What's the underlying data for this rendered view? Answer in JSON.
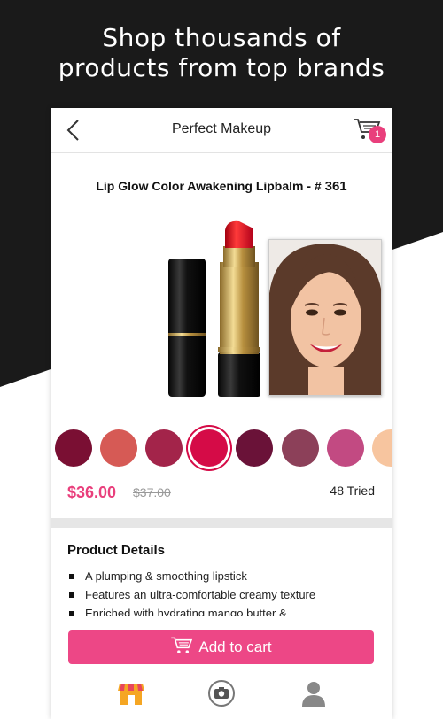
{
  "headline": {
    "line1": "Shop thousands of",
    "line2": "products from top brands"
  },
  "navbar": {
    "title": "Perfect Makeup",
    "cart_count": "1"
  },
  "product": {
    "name": "Lip Glow Color Awakening Lipbalm - # ",
    "shade_number": "361",
    "price": "$36.00",
    "original_price": "$37.00",
    "tried_count": "48 Tried"
  },
  "swatches": [
    {
      "color": "#7a0f33"
    },
    {
      "color": "#d65a55"
    },
    {
      "color": "#a3244a"
    },
    {
      "color": "#d50b47",
      "selected": true
    },
    {
      "color": "#6a1238"
    },
    {
      "color": "#8c4059"
    },
    {
      "color": "#c24a82"
    },
    {
      "color": "#f7c59f"
    }
  ],
  "details": {
    "title": "Product Details",
    "items": [
      "A plumping & smoothing lipstick",
      "Features an ultra-comfortable creamy texture",
      "Enriched with hydrating mango butter &"
    ]
  },
  "actions": {
    "add_to_cart": "Add to cart"
  },
  "colors": {
    "accent": "#ed4786",
    "badge": "#e93f7c",
    "dark_bg": "#1a1a1a",
    "shop_tab": "#f5a623"
  },
  "tabs": [
    {
      "icon": "store-icon",
      "active": true
    },
    {
      "icon": "camera-icon"
    },
    {
      "icon": "profile-icon"
    }
  ]
}
